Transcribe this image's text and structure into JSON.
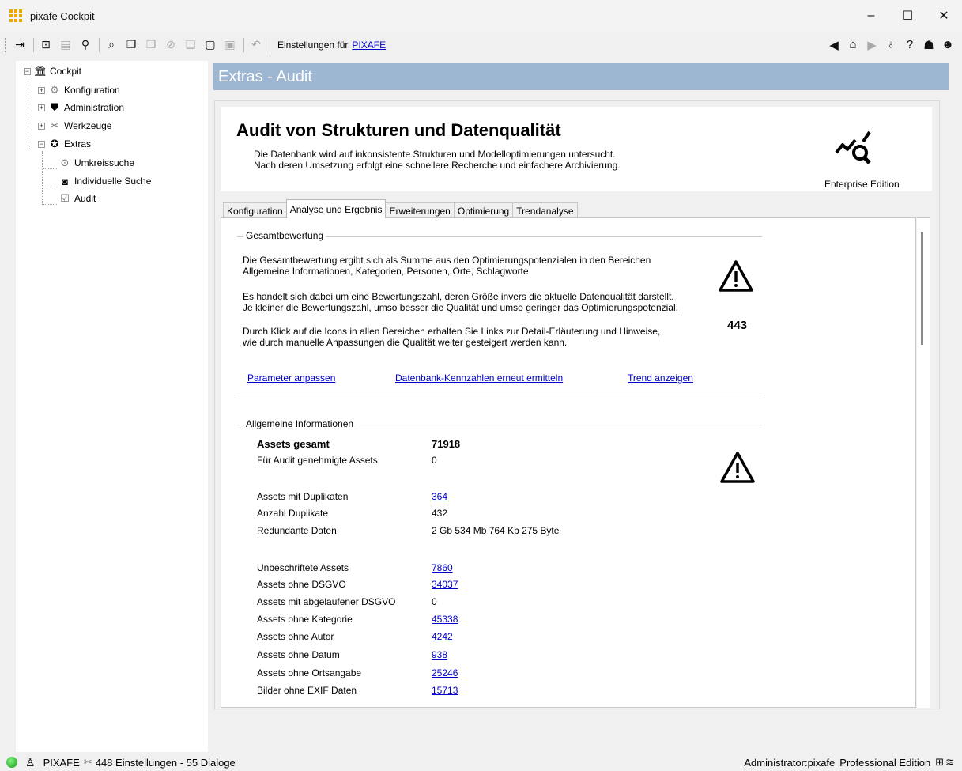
{
  "window": {
    "title": "pixafe Cockpit",
    "minimize": "–",
    "maximize": "☐",
    "close": "✕"
  },
  "toolbar": {
    "settings_label": "Einstellungen für",
    "settings_link": "PIXAFE"
  },
  "tree": {
    "root": "Cockpit",
    "items": [
      {
        "label": "Konfiguration"
      },
      {
        "label": "Administration"
      },
      {
        "label": "Werkzeuge"
      },
      {
        "label": "Extras"
      }
    ],
    "extras_children": [
      {
        "label": "Umkreissuche"
      },
      {
        "label": "Individuelle Suche"
      },
      {
        "label": "Audit"
      }
    ]
  },
  "header": {
    "title": "Extras - Audit"
  },
  "banner": {
    "title": "Audit von Strukturen und Datenqualität",
    "desc_line1": "Die Datenbank wird auf inkonsistente Strukturen und Modelloptimierungen untersucht.",
    "desc_line2": "Nach deren Umsetzung erfolgt eine schnellere Recherche und einfachere Archivierung.",
    "edition": "Enterprise Edition"
  },
  "tabs": [
    {
      "label": "Konfiguration"
    },
    {
      "label": "Analyse und Ergebnis"
    },
    {
      "label": "Erweiterungen"
    },
    {
      "label": "Optimierung"
    },
    {
      "label": "Trendanalyse"
    }
  ],
  "gesamt": {
    "label": "Gesamtbewertung",
    "p1_l1": "Die Gesamtbewertung ergibt sich als Summe aus den Optimierungspotenzialen in den Bereichen",
    "p1_l2": "Allgemeine Informationen, Kategorien, Personen, Orte, Schlagworte.",
    "p2_l1": "Es handelt sich dabei um eine Bewertungszahl, deren Größe invers die aktuelle Datenqualität darstellt.",
    "p2_l2": "Je kleiner die Bewertungszahl, umso besser die Qualität und umso geringer das Optimierungspotenzial.",
    "p3_l1": "Durch Klick auf die Icons in allen Bereichen erhalten Sie Links zur Detail-Erläuterung und Hinweise,",
    "p3_l2": "wie durch manuelle Anpassungen die Qualität weiter gesteigert werden kann.",
    "score": "443",
    "link_params": "Parameter anpassen",
    "link_recalc": "Datenbank-Kennzahlen erneut ermitteln",
    "link_trend": "Trend anzeigen"
  },
  "allgemein": {
    "label": "Allgemeine Informationen",
    "rows": [
      {
        "label": "Assets gesamt",
        "value": "71918"
      },
      {
        "label": "Für Audit genehmigte Assets",
        "value": "0"
      },
      {
        "label": "Assets mit Duplikaten",
        "value": "364"
      },
      {
        "label": "Anzahl Duplikate",
        "value": "432"
      },
      {
        "label": "Redundante Daten",
        "value": "2 Gb 534 Mb 764 Kb 275 Byte"
      },
      {
        "label": "Unbeschriftete Assets",
        "value": "7860"
      },
      {
        "label": "Assets ohne DSGVO",
        "value": "34037"
      },
      {
        "label": "Assets mit abgelaufener  DSGVO",
        "value": "0"
      },
      {
        "label": "Assets ohne Kategorie",
        "value": "45338"
      },
      {
        "label": "Assets ohne Autor",
        "value": "4242"
      },
      {
        "label": "Assets ohne Datum",
        "value": "938"
      },
      {
        "label": "Assets ohne Ortsangabe",
        "value": "25246"
      },
      {
        "label": "Bilder ohne EXIF Daten",
        "value": "15713"
      }
    ]
  },
  "status": {
    "left": "PIXAFE",
    "info": "448 Einstellungen - 55 Dialoge",
    "user": "Administrator:pixafe",
    "edition": "Professional Edition"
  }
}
